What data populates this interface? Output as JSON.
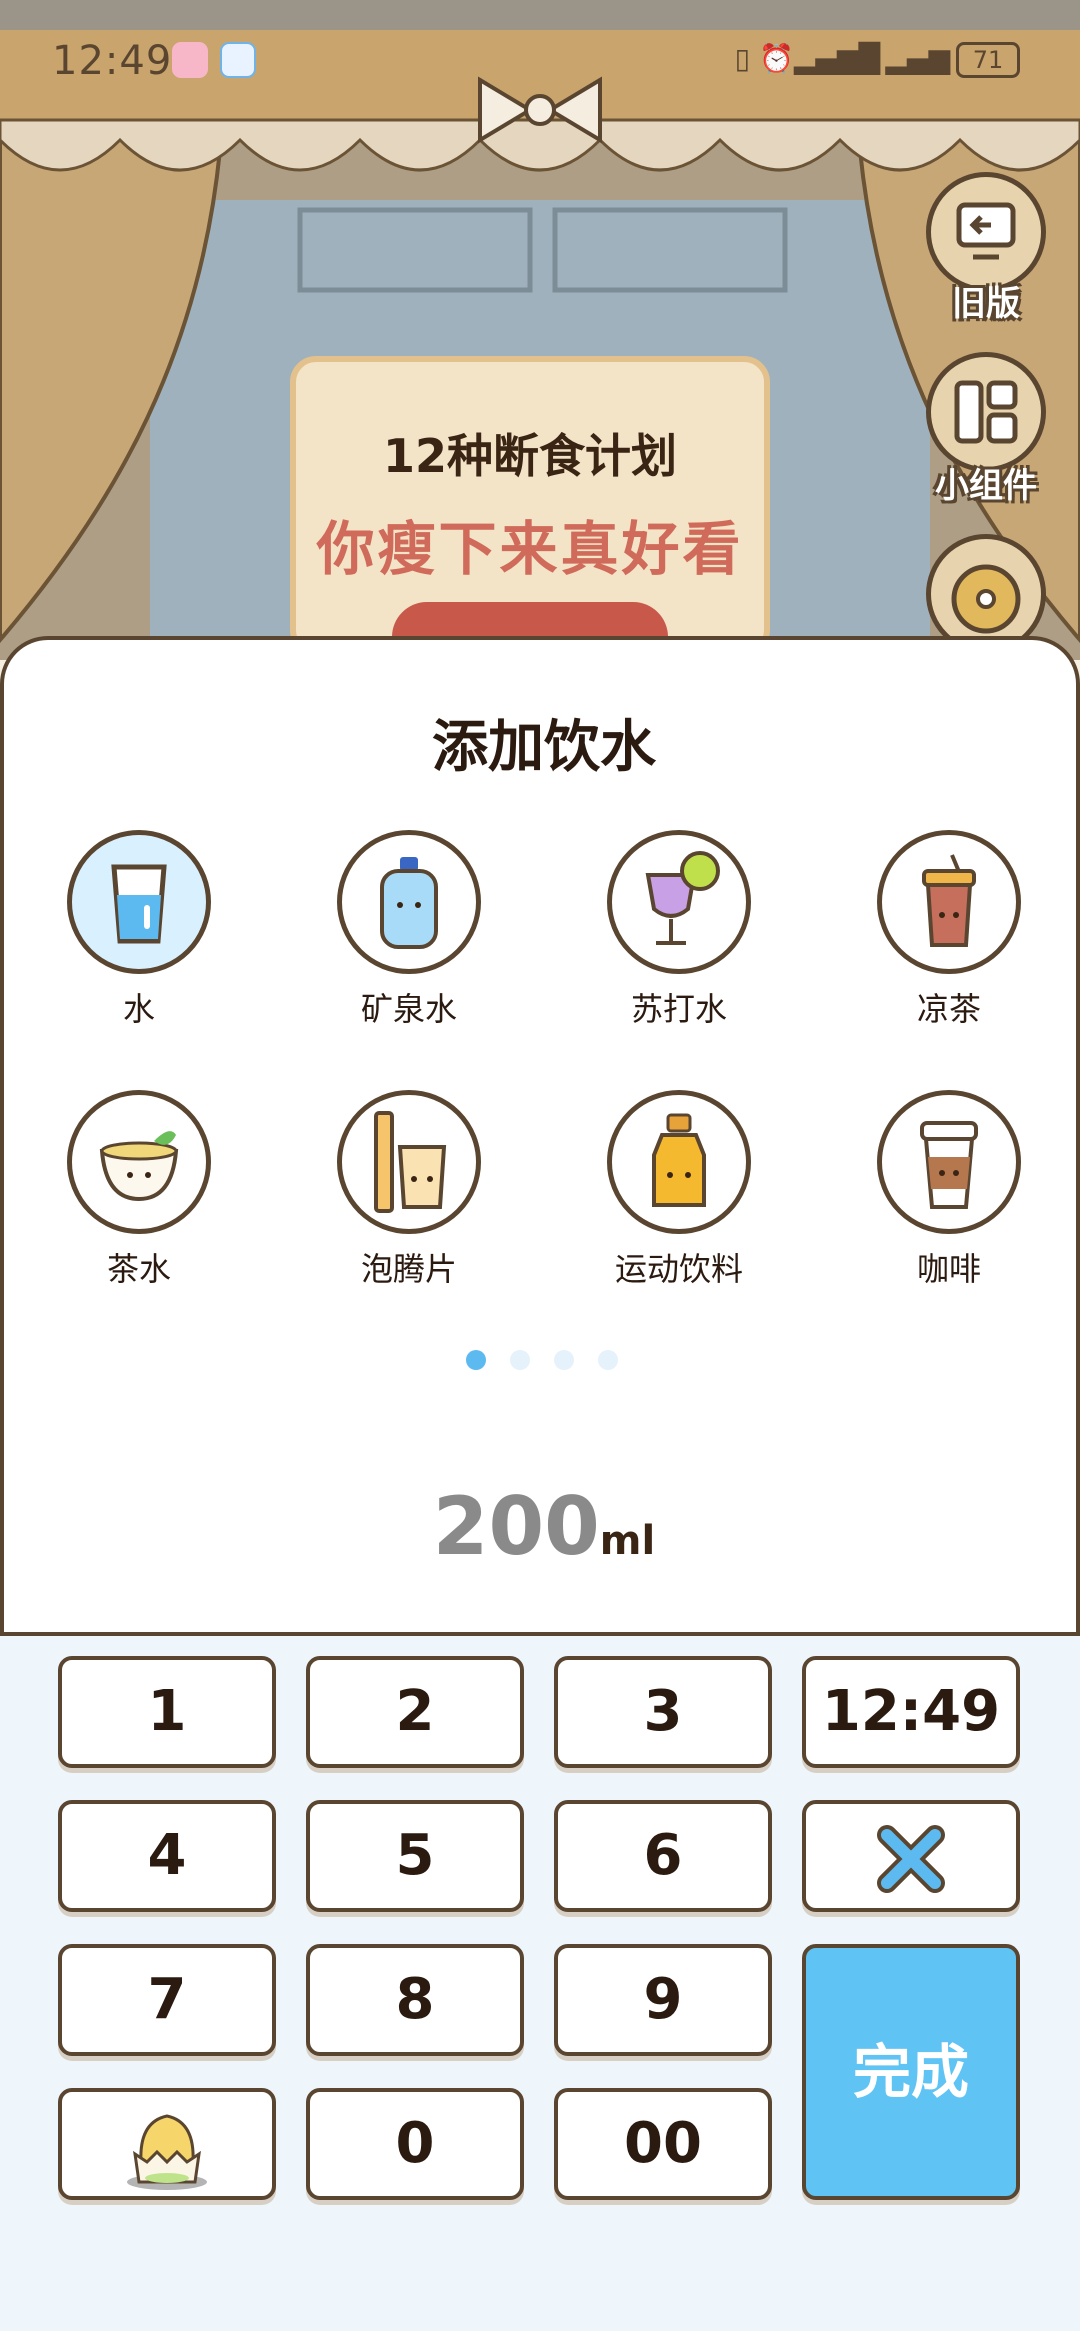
{
  "status_bar": {
    "time": "12:49",
    "battery": "71"
  },
  "side_buttons": [
    {
      "label": "旧版",
      "icon": "monitor-back-icon"
    },
    {
      "label": "小组件",
      "icon": "widget-grid-icon"
    },
    {
      "label": "",
      "icon": "wheel-icon"
    }
  ],
  "banner": {
    "line1": "12种断食计划",
    "line2": "你瘦下来真好看"
  },
  "sheet": {
    "title": "添加饮水",
    "drinks": [
      {
        "label": "水",
        "icon": "water-glass-icon",
        "selected": true
      },
      {
        "label": "矿泉水",
        "icon": "mineral-water-bottle-icon"
      },
      {
        "label": "苏打水",
        "icon": "soda-glass-icon"
      },
      {
        "label": "凉茶",
        "icon": "herbal-tea-cup-icon"
      },
      {
        "label": "茶水",
        "icon": "tea-bowl-icon"
      },
      {
        "label": "泡腾片",
        "icon": "effervescent-tablet-icon"
      },
      {
        "label": "运动饮料",
        "icon": "sports-drink-icon"
      },
      {
        "label": "咖啡",
        "icon": "coffee-cup-icon"
      }
    ],
    "page_count": 4,
    "active_page": 1,
    "amount_value": "200",
    "amount_unit": "ml"
  },
  "keypad": {
    "k1": "1",
    "k2": "2",
    "k3": "3",
    "time": "12:49",
    "k4": "4",
    "k5": "5",
    "k6": "6",
    "k7": "7",
    "k8": "8",
    "k9": "9",
    "k0": "0",
    "k00": "00",
    "done": "完成",
    "delete_icon": "delete-x-icon",
    "mascot_icon": "egg-mascot-icon"
  }
}
